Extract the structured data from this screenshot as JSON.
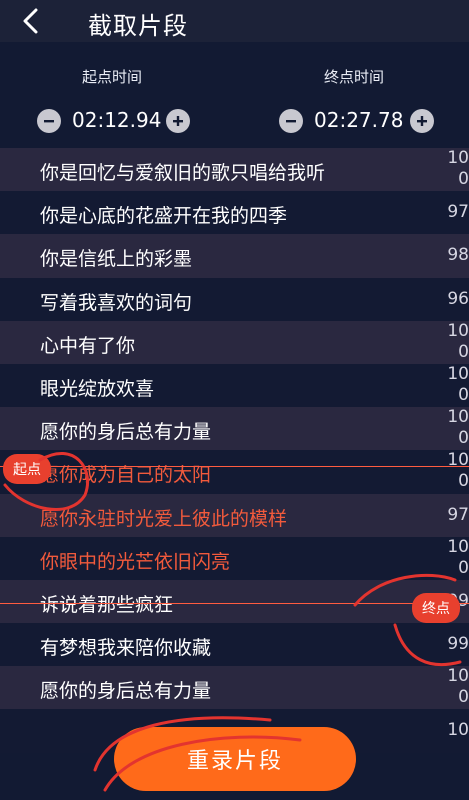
{
  "header": {
    "title": "截取片段"
  },
  "times": {
    "start_label": "起点时间",
    "end_label": "终点时间",
    "start_value": "02:12.94",
    "end_value": "02:27.78"
  },
  "lyrics": [
    {
      "text": "你是回忆与爱叙旧的歌只唱给我听",
      "num": "10\n0",
      "selected": false
    },
    {
      "text": "你是心底的花盛开在我的四季",
      "num": "97",
      "selected": false
    },
    {
      "text": "你是信纸上的彩墨",
      "num": "98",
      "selected": false
    },
    {
      "text": "写着我喜欢的词句",
      "num": "96",
      "selected": false
    },
    {
      "text": "心中有了你",
      "num": "10\n0",
      "selected": false
    },
    {
      "text": "眼光绽放欢喜",
      "num": "10\n0",
      "selected": false
    },
    {
      "text": "愿你的身后总有力量",
      "num": "10\n0",
      "selected": false
    },
    {
      "text": "愿你成为自己的太阳",
      "num": "10\n0",
      "selected": true
    },
    {
      "text": "愿你永驻时光爱上彼此的模样",
      "num": "97",
      "selected": true
    },
    {
      "text": "你眼中的光芒依旧闪亮",
      "num": "10\n0",
      "selected": true
    },
    {
      "text": "诉说着那些疯狂",
      "num": "99",
      "selected": false
    },
    {
      "text": "有梦想我来陪你收藏",
      "num": "99",
      "selected": false
    },
    {
      "text": "愿你的身后总有力量",
      "num": "10\n0",
      "selected": false
    },
    {
      "text": "",
      "num": "10",
      "selected": false
    }
  ],
  "markers": {
    "start": "起点",
    "end": "终点"
  },
  "actions": {
    "redo": "重录片段"
  },
  "colors": {
    "accent": "#ff6a1a",
    "selected_text": "#f25a3c",
    "marker": "#e8402e"
  }
}
